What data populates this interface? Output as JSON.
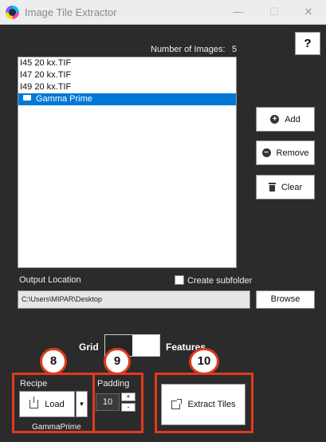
{
  "window": {
    "title": "Image Tile Extractor",
    "minimize_glyph": "—",
    "maximize_glyph": "☐",
    "close_glyph": "✕"
  },
  "help_label": "?",
  "images": {
    "count_label": "Number of Images:",
    "count_value": "5",
    "items": [
      {
        "label": "I45 20 kx.TIF",
        "selected": false
      },
      {
        "label": "I47 20 kx.TIF",
        "selected": false
      },
      {
        "label": "I49 20 kx.TIF",
        "selected": false
      },
      {
        "label": "Gamma Prime",
        "selected": true,
        "is_folder": true
      }
    ]
  },
  "buttons": {
    "add": "Add",
    "remove": "Remove",
    "clear": "Clear",
    "browse": "Browse",
    "load": "Load",
    "extract": "Extract Tiles"
  },
  "output": {
    "label": "Output Location",
    "create_subfolder_label": "Create subfolder",
    "create_subfolder_checked": false,
    "path": "C:\\Users\\MIPAR\\Desktop"
  },
  "mode_toggle": {
    "left_label": "Grid",
    "right_label": "Features",
    "selected": "Grid"
  },
  "recipe": {
    "label": "Recipe",
    "name": "GammaPrime"
  },
  "padding": {
    "label": "Padding",
    "value": "10",
    "increment_label": "+",
    "decrement_label": "-"
  },
  "callouts": [
    "8",
    "9",
    "10"
  ],
  "colors": {
    "background": "#2b2b2b",
    "selection": "#0078d7",
    "callout_red": "#e03a1e"
  }
}
